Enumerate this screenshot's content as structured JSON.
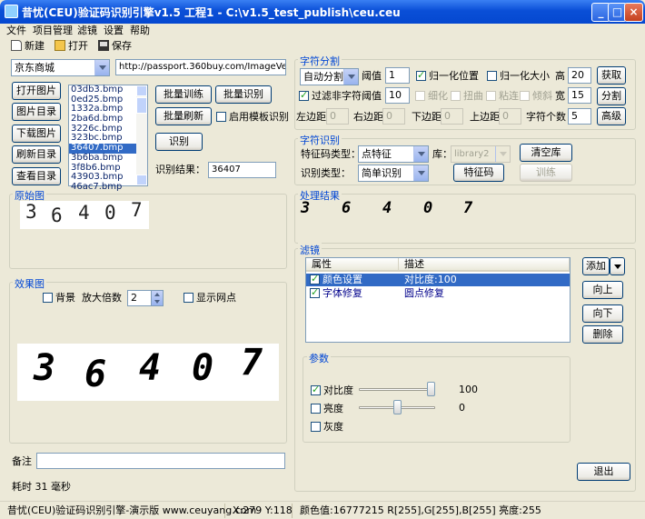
{
  "window": {
    "title": "昔忧(CEU)验证码识别引擎v1.5 工程1 - C:\\v1.5_test_publish\\ceu.ceu",
    "min": "_",
    "max": "□",
    "close": "×"
  },
  "menu": [
    "文件",
    "项目管理",
    "滤镜",
    "设置",
    "帮助"
  ],
  "toolbar": {
    "new": "新建",
    "open": "打开",
    "save": "保存"
  },
  "left": {
    "site_combo": "京东商城",
    "url": "http://passport.360buy.com/ImageVerifier.axd?",
    "btn_open_image": "打开图片",
    "btn_image_dir": "图片目录",
    "btn_download": "下载图片",
    "btn_refresh_dir": "刷新目录",
    "btn_view_dir": "查看目录",
    "files": [
      "03db3.bmp",
      "0ed25.bmp",
      "1332a.bmp",
      "2ba6d.bmp",
      "3226c.bmp",
      "323bc.bmp",
      "36407.bmp",
      "3b6ba.bmp",
      "3f8b6.bmp",
      "43903.bmp",
      "46ac7.bmp"
    ],
    "selected_file_index": 6,
    "btn_batch_train": "批量训练",
    "btn_batch_recognize": "批量识别",
    "btn_batch_refresh": "批量刷新",
    "enable_template": "启用模板识别",
    "btn_recognize": "识别",
    "result_label": "识别结果：",
    "result_value": "36407",
    "original_title": "原始图",
    "effect_title": "效果图",
    "bg_check": "背景",
    "zoom_label": "放大倍数",
    "zoom_value": "2",
    "show_grid": "显示网点",
    "note_label": "备注",
    "time_label": "耗时 31 毫秒"
  },
  "captcha_digits": [
    "3",
    "6",
    "4",
    "0",
    "7"
  ],
  "segment": {
    "title": "字符分割",
    "mode": "自动分割",
    "threshold_label": "阈值",
    "threshold_value": "1",
    "normalize_pos": "归一化位置",
    "normalize_size": "归一化大小",
    "height_label": "高",
    "height_value": "20",
    "btn_get": "获取",
    "filter_nonchar": "过滤非字符",
    "threshold2_label": "阈值",
    "threshold2_value": "10",
    "thin": "细化",
    "distort": "扭曲",
    "sticky": "粘连",
    "tilt": "倾斜",
    "width_label": "宽",
    "width_value": "15",
    "btn_split": "分割",
    "left_margin": "左边距",
    "right_margin": "右边距",
    "bottom_margin": "下边距",
    "top_margin": "上边距",
    "margin_left_value": "0",
    "margin_right_value": "0",
    "margin_bottom_value": "0",
    "margin_top_value": "0",
    "char_count_label": "字符个数",
    "char_count_value": "5",
    "btn_advanced": "高级"
  },
  "recognize": {
    "title": "字符识别",
    "feature_type_label": "特征码类型：",
    "feature_type": "点特征",
    "library_label": "库：",
    "library_value": "library2",
    "btn_clear_lib": "清空库",
    "recognize_type_label": "识别类型：",
    "recognize_type": "简单识别",
    "btn_feature": "特征码",
    "btn_train": "训练"
  },
  "processed_title": "处理结果",
  "filter": {
    "title": "滤镜",
    "col_attr": "属性",
    "col_desc": "描述",
    "rows": [
      {
        "attr": "颜色设置",
        "desc": "对比度:100",
        "checked": true,
        "selected": true
      },
      {
        "attr": "字体修复",
        "desc": "圆点修复",
        "checked": true,
        "selected": false
      }
    ],
    "btn_add": "添加",
    "btn_up": "向上",
    "btn_down": "向下",
    "btn_delete": "删除"
  },
  "params": {
    "title": "参数",
    "contrast": "对比度",
    "contrast_value": "100",
    "contrast_level": 1.0,
    "brightness": "亮度",
    "brightness_value": "0",
    "brightness_level": 0.5,
    "gray": "灰度"
  },
  "btn_exit": "退出",
  "status": {
    "app": "昔忧(CEU)验证码识别引擎-演示版 www.ceuyang.com",
    "coords": "X:279 Y:118",
    "color": "颜色值:16777215 R[255],G[255],B[255] 亮度:255"
  }
}
